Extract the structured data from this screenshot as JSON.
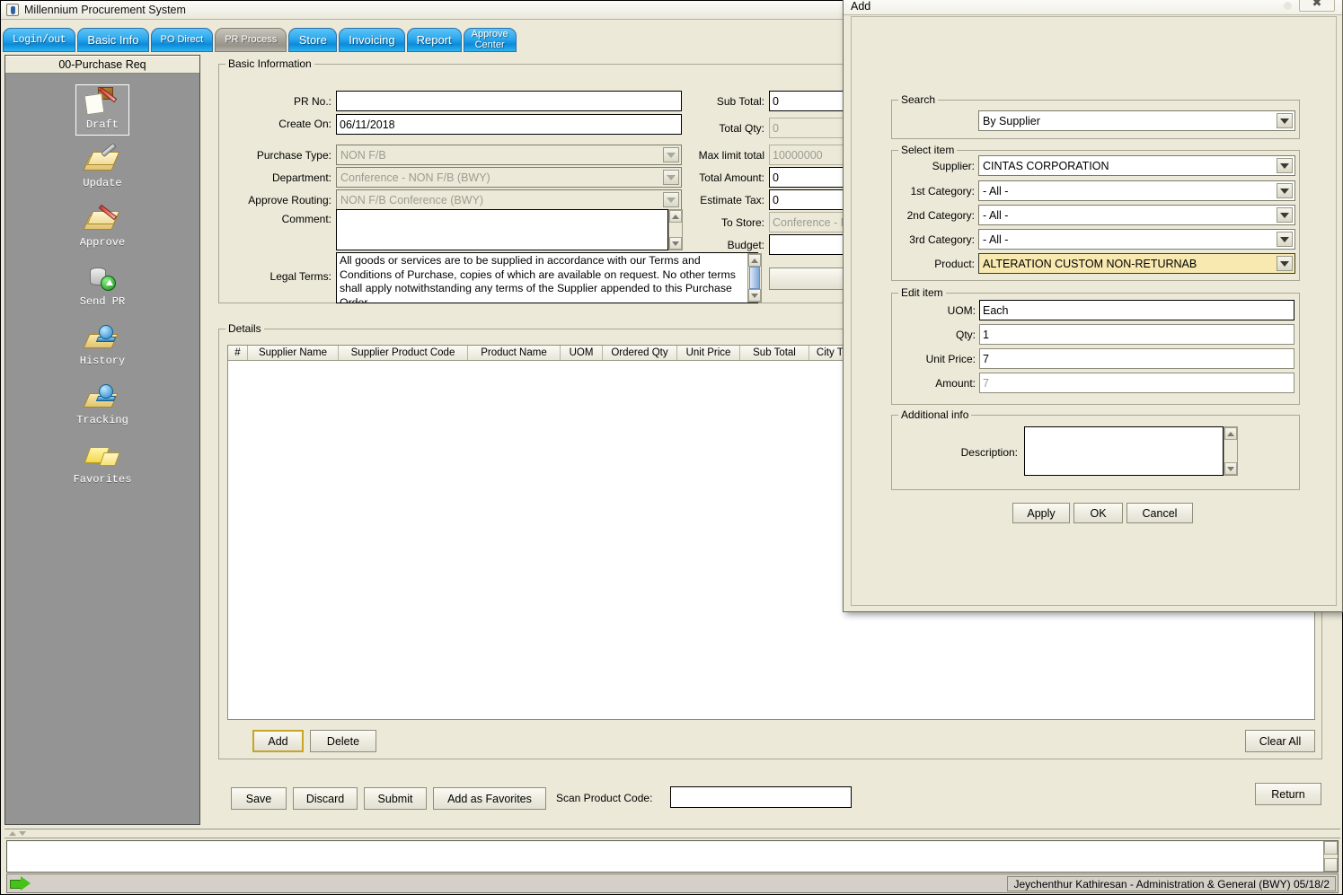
{
  "window": {
    "title": "Millennium Procurement System",
    "icon": "java-coffee-icon"
  },
  "tabs": [
    {
      "label": "Login/out",
      "active": false
    },
    {
      "label": "Basic Info",
      "active": false
    },
    {
      "label": "PO Direct",
      "active": false
    },
    {
      "label": "PR Process",
      "active": true
    },
    {
      "label": "Store",
      "active": false
    },
    {
      "label": "Invoicing",
      "active": false
    },
    {
      "label": "Report",
      "active": false
    },
    {
      "label": "Approve\nCenter",
      "active": false
    }
  ],
  "sidebar": {
    "header": "00-Purchase Req",
    "items": [
      {
        "label": "Draft",
        "icon": "draft-box-document-icon",
        "selected": true
      },
      {
        "label": "Update",
        "icon": "folder-wrench-icon",
        "selected": false
      },
      {
        "label": "Approve",
        "icon": "folder-pencil-icon",
        "selected": false
      },
      {
        "label": "Send PR",
        "icon": "database-upload-icon",
        "selected": false
      },
      {
        "label": "History",
        "icon": "folder-globe-icon",
        "selected": false
      },
      {
        "label": "Tracking",
        "icon": "folder-globe-icon",
        "selected": false
      },
      {
        "label": "Favorites",
        "icon": "notes-icon",
        "selected": false
      }
    ]
  },
  "basic_information": {
    "legend": "Basic Information",
    "fields": {
      "pr_no_label": "PR No.:",
      "pr_no_value": "",
      "create_on_label": "Create On:",
      "create_on_value": "06/11/2018",
      "purchase_type_label": "Purchase Type:",
      "purchase_type_value": "NON F/B",
      "department_label": "Department:",
      "department_value": "Conference - NON F/B (BWY)",
      "approve_routing_label": "Approve Routing:",
      "approve_routing_value": "NON F/B Conference (BWY)",
      "comment_label": "Comment:",
      "comment_value": "",
      "legal_terms_label": "Legal Terms:",
      "legal_terms_value": "All goods or services are to be supplied in accordance with our Terms and Conditions of Purchase, copies of which are available on request. No other terms shall apply notwithstanding any terms of the Supplier appended to this Purchase Order.",
      "sub_total_label": "Sub Total:",
      "sub_total_value": "0",
      "total_qty_label": "Total Qty:",
      "total_qty_value": "0",
      "max_limit_total_label": "Max limit total",
      "max_limit_total_value": "10000000",
      "total_amount_label": "Total Amount:",
      "total_amount_value": "0",
      "estimate_tax_label": "Estimate Tax:",
      "estimate_tax_value": "0",
      "to_store_label": "To Store:",
      "to_store_value": "Conference - NO",
      "budget_label": "Budget:",
      "budget_value": ""
    }
  },
  "details": {
    "legend": "Details",
    "columns": [
      "#",
      "Supplier Name",
      "Supplier Product Code",
      "Product Name",
      "UOM",
      "Ordered Qty",
      "Unit Price",
      "Sub Total",
      "City Tax Rate"
    ],
    "rows": [],
    "buttons": {
      "add": "Add",
      "delete": "Delete",
      "clear_all": "Clear All"
    }
  },
  "footer": {
    "save": "Save",
    "discard": "Discard",
    "submit": "Submit",
    "add_as_favorites": "Add as Favorites",
    "scan_product_code_label": "Scan Product Code:",
    "scan_product_code_value": "",
    "return": "Return"
  },
  "statusbar": {
    "user": "Jeychenthur Kathiresan - Administration & General (BWY)   05/18/2"
  },
  "dialog": {
    "title": "Add",
    "close_icon": "close-icon",
    "search": {
      "legend": "Search",
      "value": "By Supplier"
    },
    "select_item": {
      "legend": "Select item",
      "supplier_label": "Supplier:",
      "supplier_value": "CINTAS CORPORATION",
      "cat1_label": "1st Category:",
      "cat1_value": "- All -",
      "cat2_label": "2nd Category:",
      "cat2_value": "- All -",
      "cat3_label": "3rd Category:",
      "cat3_value": "- All -",
      "product_label": "Product:",
      "product_value": "ALTERATION CUSTOM NON-RETURNAB",
      "product_highlight_color": "#f7e9b0"
    },
    "edit_item": {
      "legend": "Edit item",
      "uom_label": "UOM:",
      "uom_value": "Each",
      "qty_label": "Qty:",
      "qty_value": "1",
      "unit_price_label": "Unit Price:",
      "unit_price_value": "7",
      "amount_label": "Amount:",
      "amount_value": "7"
    },
    "additional_info": {
      "legend": "Additional info",
      "description_label": "Description:",
      "description_value": ""
    },
    "buttons": {
      "apply": "Apply",
      "ok": "OK",
      "cancel": "Cancel"
    }
  },
  "colors": {
    "tab_active": "#a9a79c",
    "tab_inactive": "#2ba8ee",
    "panel_bg": "#ece9d8",
    "sidebar_bg": "#949494",
    "highlight": "#f7e9b0"
  }
}
